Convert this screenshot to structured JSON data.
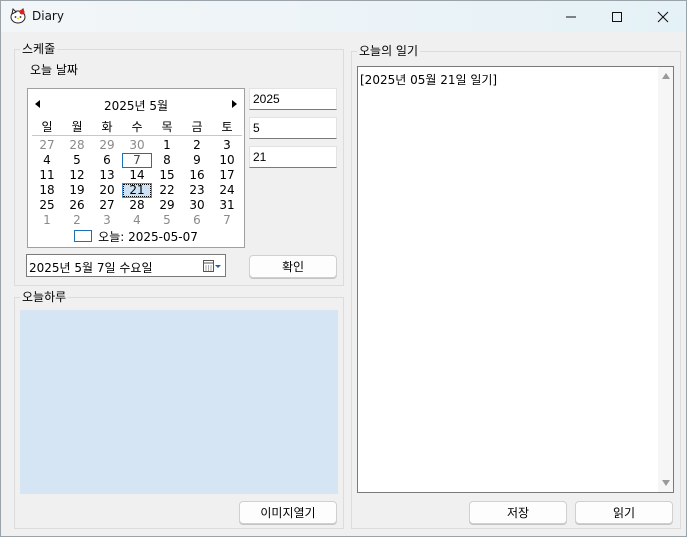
{
  "window": {
    "title": "Diary",
    "icon": "hello-kitty-icon"
  },
  "schedule": {
    "group_label": "스케줄",
    "today_date_label": "오늘 날짜",
    "calendar": {
      "month_title": "2025년 5월",
      "weekdays": [
        "일",
        "월",
        "화",
        "수",
        "목",
        "금",
        "토"
      ],
      "weeks": [
        [
          "27",
          "28",
          "29",
          "30",
          "1",
          "2",
          "3"
        ],
        [
          "4",
          "5",
          "6",
          "7",
          "8",
          "9",
          "10"
        ],
        [
          "11",
          "12",
          "13",
          "14",
          "15",
          "16",
          "17"
        ],
        [
          "18",
          "19",
          "20",
          "21",
          "22",
          "23",
          "24"
        ],
        [
          "25",
          "26",
          "27",
          "28",
          "29",
          "30",
          "31"
        ],
        [
          "1",
          "2",
          "3",
          "4",
          "5",
          "6",
          "7"
        ]
      ],
      "today_day": "7",
      "selected_day": "21",
      "today_footer": "오늘: 2025-05-07"
    },
    "year_field": "2025",
    "month_field": "5",
    "day_field": "21",
    "date_picker_value": "2025년   5월   7일 수요일",
    "confirm_label": "확인"
  },
  "daily": {
    "group_label": "오늘하루",
    "open_image_label": "이미지열기"
  },
  "diary": {
    "group_label": "오늘의 일기",
    "text": "[2025년 05월 21일 일기]",
    "save_label": "저장",
    "read_label": "읽기"
  },
  "colors": {
    "picture_background": "#d6e5f3",
    "today_outline": "#1f6fb2",
    "selected_background": "#cde2f5"
  }
}
